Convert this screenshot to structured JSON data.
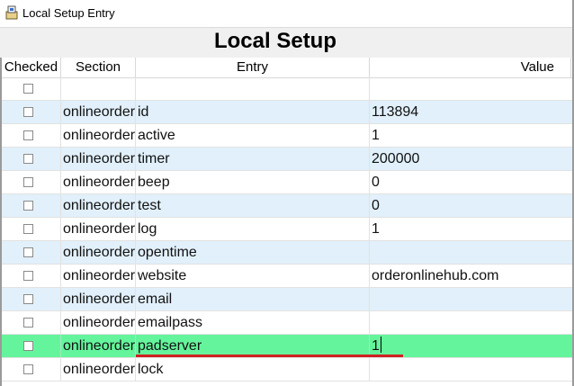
{
  "window": {
    "title": "Local Setup Entry"
  },
  "heading": "Local Setup",
  "columns": {
    "checked": "Checked",
    "section": "Section",
    "entry": "Entry",
    "value": "Value"
  },
  "rows": [
    {
      "section": "",
      "entry": "",
      "value": ""
    },
    {
      "section": "onlineorder",
      "entry": "id",
      "value": "113894"
    },
    {
      "section": "onlineorder",
      "entry": "active",
      "value": "1"
    },
    {
      "section": "onlineorder",
      "entry": "timer",
      "value": "200000"
    },
    {
      "section": "onlineorder",
      "entry": "beep",
      "value": "0"
    },
    {
      "section": "onlineorder",
      "entry": "test",
      "value": "0"
    },
    {
      "section": "onlineorder",
      "entry": "log",
      "value": "1"
    },
    {
      "section": "onlineorder",
      "entry": "opentime",
      "value": ""
    },
    {
      "section": "onlineorder",
      "entry": "website",
      "value": "orderonlinehub.com"
    },
    {
      "section": "onlineorder",
      "entry": "email",
      "value": ""
    },
    {
      "section": "onlineorder",
      "entry": "emailpass",
      "value": ""
    },
    {
      "section": "onlineorder",
      "entry": "padserver",
      "value": "1"
    },
    {
      "section": "onlineorder",
      "entry": "lock",
      "value": ""
    }
  ],
  "colors": {
    "stripe": "#e1f0fb",
    "selected": "#64f59c",
    "underline": "#cf2020"
  },
  "icons": {
    "app": "app-icon"
  }
}
